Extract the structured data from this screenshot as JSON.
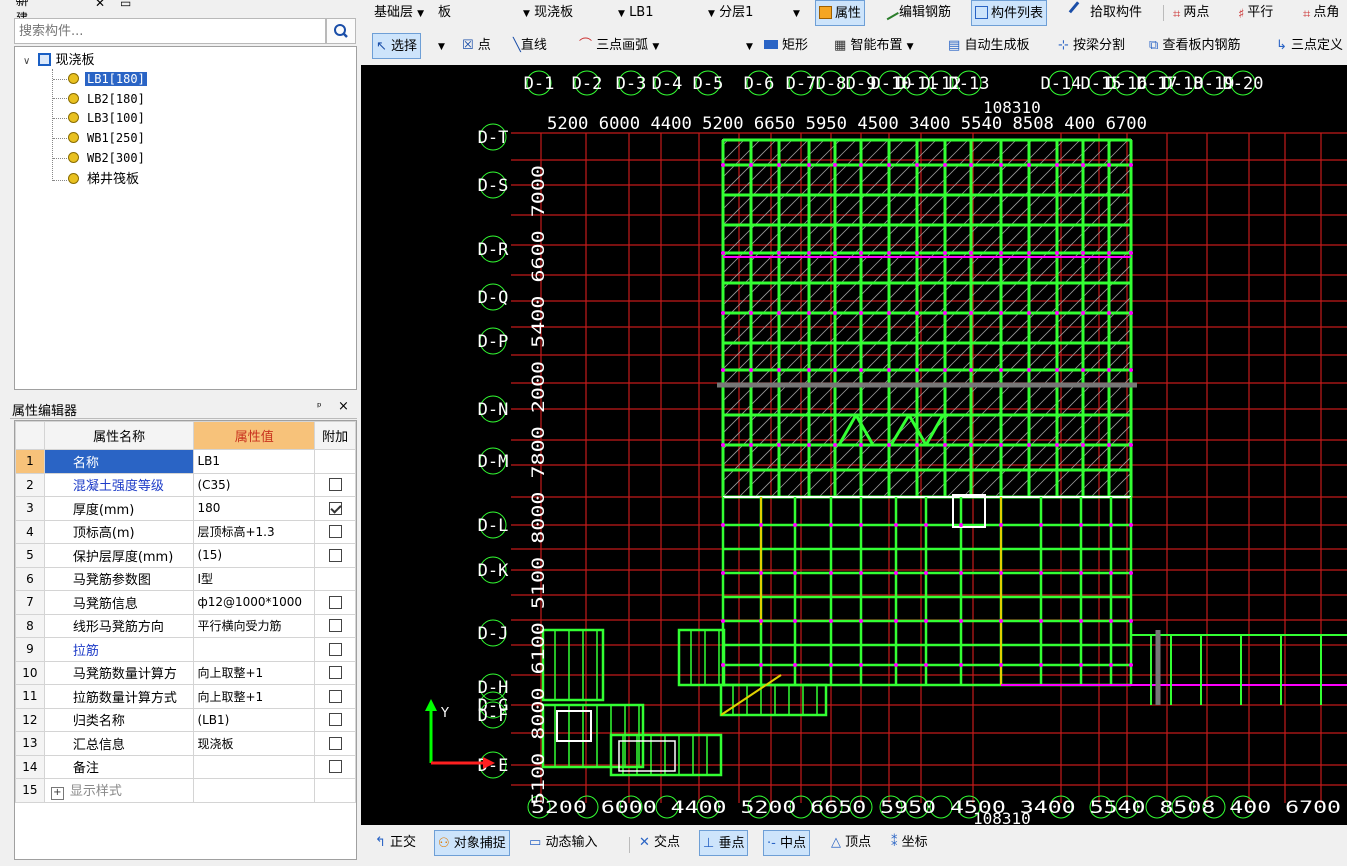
{
  "left_toolbar": {
    "new_label": "新建"
  },
  "search": {
    "placeholder": "搜索构件..."
  },
  "tree": {
    "root_label": "现浇板",
    "children": [
      "LB1[180]",
      "LB2[180]",
      "LB3[100]",
      "WB1[250]",
      "WB2[300]",
      "梯井筏板"
    ]
  },
  "property_editor": {
    "title": "属性编辑器",
    "pin_glyph": "ᵖ",
    "close_glyph": "×",
    "headers": {
      "name": "属性名称",
      "value": "属性值",
      "extra": "附加"
    },
    "rows": [
      {
        "num": "1",
        "name": "名称",
        "value": "LB1"
      },
      {
        "num": "2",
        "name": "混凝土强度等级",
        "value": "(C35)"
      },
      {
        "num": "3",
        "name": "厚度(mm)",
        "value": "180"
      },
      {
        "num": "4",
        "name": "顶标高(m)",
        "value": "层顶标高+1.3"
      },
      {
        "num": "5",
        "name": "保护层厚度(mm)",
        "value": "(15)"
      },
      {
        "num": "6",
        "name": "马凳筋参数图",
        "value": "I型"
      },
      {
        "num": "7",
        "name": "马凳筋信息",
        "value": "ф12@1000*1000"
      },
      {
        "num": "8",
        "name": "线形马凳筋方向",
        "value": "平行横向受力筋"
      },
      {
        "num": "9",
        "name": "拉筋",
        "value": ""
      },
      {
        "num": "10",
        "name": "马凳筋数量计算方",
        "value": "向上取整+1"
      },
      {
        "num": "11",
        "name": "拉筋数量计算方式",
        "value": "向上取整+1"
      },
      {
        "num": "12",
        "name": "归类名称",
        "value": "(LB1)"
      },
      {
        "num": "13",
        "name": "汇总信息",
        "value": "现浇板"
      },
      {
        "num": "14",
        "name": "备注",
        "value": ""
      },
      {
        "num": "15",
        "name": "显示样式",
        "value": ""
      }
    ],
    "expand_glyph": "+"
  },
  "toolbar1": {
    "floor": "基础层",
    "category": "板",
    "type": "现浇板",
    "component": "LB1",
    "layer": "分层1",
    "properties": "属性",
    "edit_rebar": "编辑钢筋",
    "component_list": "构件列表",
    "pick_component": "拾取构件",
    "two_points": "两点",
    "parallel": "平行",
    "point_angle": "点角"
  },
  "toolbar2": {
    "select": "选择",
    "point": "点",
    "line": "直线",
    "arc3": "三点画弧",
    "rectangle": "矩形",
    "smart_layout": "智能布置",
    "auto_generate": "自动生成板",
    "split_by_beam": "按梁分割",
    "view_rebar": "查看板内钢筋",
    "three_point_axis": "三点定义"
  },
  "canvas": {
    "top_axes": [
      "D-1",
      "D-2",
      "D-3",
      "D-4",
      "D-5",
      "D-6",
      "D-7",
      "D-8",
      "D-9",
      "D-10",
      "D-11",
      "D-12",
      "D-13",
      "D-14",
      "D-15",
      "D-16",
      "D-17",
      "D-18",
      "D-19",
      "D-20"
    ],
    "top_total": "108310",
    "top_dims": "5200 6000 4400 5200 6650 5950 4500 3400 5540 8508 400 6700",
    "left_axes": [
      "D-T",
      "D-S",
      "D-R",
      "D-Q",
      "D-P",
      "D-N",
      "D-M",
      "D-L",
      "D-K",
      "D-J",
      "D-H",
      "D-G",
      "D-F",
      "D-E"
    ],
    "left_dims": "5100 8000 6100 5100 8000 7800 2000 5400 6600 7000",
    "bottom_total": "108310",
    "bottom_dims": "5200 6000 4400 5200 6650 5950 4500 3400 5540 8508 400 6700",
    "y_label": "Y"
  },
  "statusbar": {
    "ortho": "正交",
    "snap": "对象捕捉",
    "dynamic_input": "动态输入",
    "intersection": "交点",
    "perpendicular": "垂点",
    "midpoint": "中点",
    "vertex": "顶点",
    "coordinate": "坐标"
  }
}
